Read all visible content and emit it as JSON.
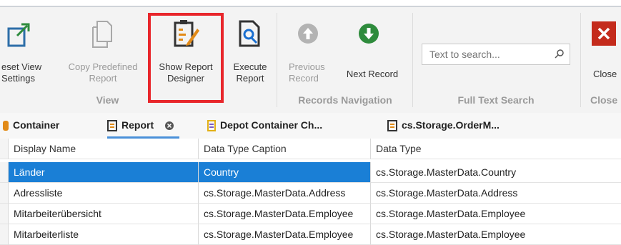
{
  "ribbon": {
    "buttons": {
      "reset_view": {
        "label": "eset View\nSettings",
        "enabled": true
      },
      "copy_predefined": {
        "label": "Copy Predefined\nReport",
        "enabled": false
      },
      "show_designer": {
        "label": "Show Report\nDesigner",
        "enabled": true
      },
      "execute_report": {
        "label": "Execute\nReport",
        "enabled": true
      },
      "previous_record": {
        "label": "Previous\nRecord",
        "enabled": false
      },
      "next_record": {
        "label": "Next Record",
        "enabled": true
      },
      "close": {
        "label": "Close",
        "enabled": true
      }
    },
    "groups": {
      "view": "View",
      "records_navigation": "Records Navigation",
      "full_text_search": "Full Text Search",
      "close": "Close"
    },
    "search": {
      "placeholder": "Text to search..."
    }
  },
  "tabs": [
    {
      "label": "Container",
      "active": false
    },
    {
      "label": "Report",
      "active": true
    },
    {
      "label": "Depot Container Ch...",
      "active": false
    },
    {
      "label": "cs.Storage.OrderM...",
      "active": false
    }
  ],
  "grid": {
    "columns": [
      "Display Name",
      "Data Type Caption",
      "Data Type"
    ],
    "rows": [
      {
        "display_name": "Länder",
        "caption": "Country",
        "data_type": "cs.Storage.MasterData.Country",
        "selected": true
      },
      {
        "display_name": "Adressliste",
        "caption": "cs.Storage.MasterData.Address",
        "data_type": "cs.Storage.MasterData.Address",
        "selected": false
      },
      {
        "display_name": "Mitarbeiterübersicht",
        "caption": "cs.Storage.MasterData.Employee",
        "data_type": "cs.Storage.MasterData.Employee",
        "selected": false
      },
      {
        "display_name": "Mitarbeiterliste",
        "caption": "cs.Storage.MasterData.Employee",
        "data_type": "cs.Storage.MasterData.Employee",
        "selected": false
      }
    ]
  },
  "colors": {
    "accent": "#1a7fd6",
    "highlight_border": "#e8262b",
    "success_green": "#2e8b3c",
    "close_red": "#c42b1c"
  }
}
